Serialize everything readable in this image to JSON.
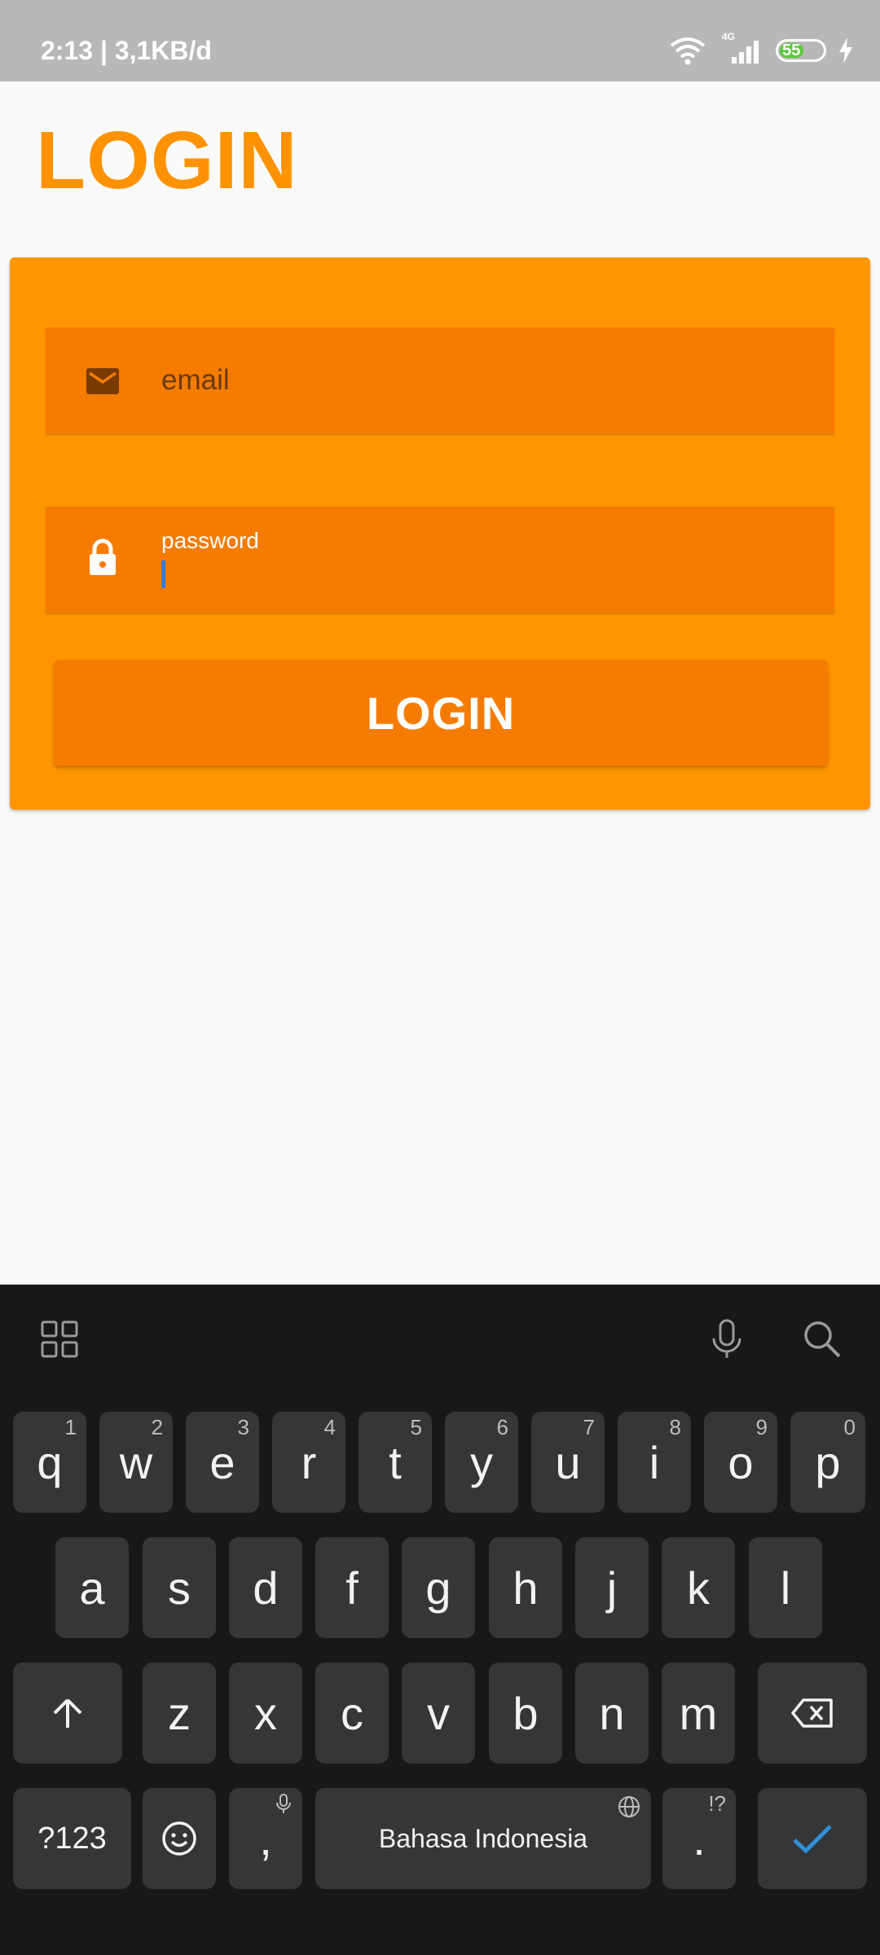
{
  "status_bar": {
    "time_speed": "2:13 | 3,1KB/d",
    "network_label": "4G",
    "battery_level": "55",
    "icons": [
      "wifi-icon",
      "signal-icon",
      "battery-icon",
      "charging-icon"
    ]
  },
  "page": {
    "title": "LOGIN"
  },
  "form": {
    "email": {
      "placeholder": "email",
      "value": "",
      "icon": "mail-icon"
    },
    "password": {
      "label": "password",
      "value": "",
      "icon": "lock-icon"
    },
    "login_button": "LOGIN"
  },
  "colors": {
    "accent": "#ff9200",
    "card": "#ff9500",
    "field": "#f57c00",
    "keyboard_bg": "#17181a",
    "key_bg": "#353638",
    "enter_check": "#2f8fd8"
  },
  "keyboard": {
    "toolbar_icons": [
      "apps-grid-icon",
      "microphone-icon",
      "search-icon"
    ],
    "row1": [
      {
        "key": "q",
        "sup": "1"
      },
      {
        "key": "w",
        "sup": "2"
      },
      {
        "key": "e",
        "sup": "3"
      },
      {
        "key": "r",
        "sup": "4"
      },
      {
        "key": "t",
        "sup": "5"
      },
      {
        "key": "y",
        "sup": "6"
      },
      {
        "key": "u",
        "sup": "7"
      },
      {
        "key": "i",
        "sup": "8"
      },
      {
        "key": "o",
        "sup": "9"
      },
      {
        "key": "p",
        "sup": "0"
      }
    ],
    "row2": [
      "a",
      "s",
      "d",
      "f",
      "g",
      "h",
      "j",
      "k",
      "l"
    ],
    "row3": [
      "z",
      "x",
      "c",
      "v",
      "b",
      "n",
      "m"
    ],
    "row4": {
      "symbols": "?123",
      "comma": ",",
      "space": "Bahasa Indonesia",
      "period": ".",
      "period_sup": "!?"
    }
  }
}
